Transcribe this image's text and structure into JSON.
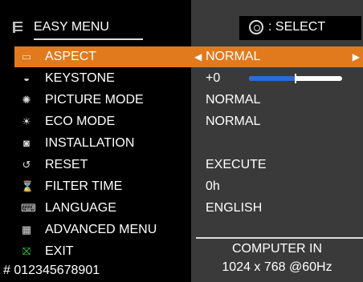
{
  "header": {
    "title": "EASY MENU",
    "select_label": ": SELECT"
  },
  "menu": [
    {
      "label": "ASPECT",
      "value": "NORMAL",
      "icon": "aspect-icon",
      "selected": true
    },
    {
      "label": "KEYSTONE",
      "value": "+0",
      "icon": "keystone-icon",
      "slider": 0.5
    },
    {
      "label": "PICTURE MODE",
      "value": "NORMAL",
      "icon": "picture-mode-icon"
    },
    {
      "label": "ECO MODE",
      "value": "NORMAL",
      "icon": "eco-mode-icon"
    },
    {
      "label": "INSTALLATION",
      "value": "",
      "icon": "installation-icon"
    },
    {
      "label": "RESET",
      "value": "EXECUTE",
      "icon": "reset-icon"
    },
    {
      "label": "FILTER TIME",
      "value": "0h",
      "icon": "filter-time-icon"
    },
    {
      "label": "LANGUAGE",
      "value": "ENGLISH",
      "icon": "language-icon"
    },
    {
      "label": "ADVANCED MENU",
      "value": "",
      "icon": "advanced-menu-icon"
    },
    {
      "label": "EXIT",
      "value": "",
      "icon": "exit-icon"
    }
  ],
  "footer": {
    "serial": "# 012345678901",
    "input_name": "COMPUTER IN",
    "input_signal": "1024 x 768 @60Hz"
  },
  "colors": {
    "highlight": "#e07a1d",
    "slider_fill": "#2a6bd9",
    "panel_bg": "#3a3a3a"
  }
}
